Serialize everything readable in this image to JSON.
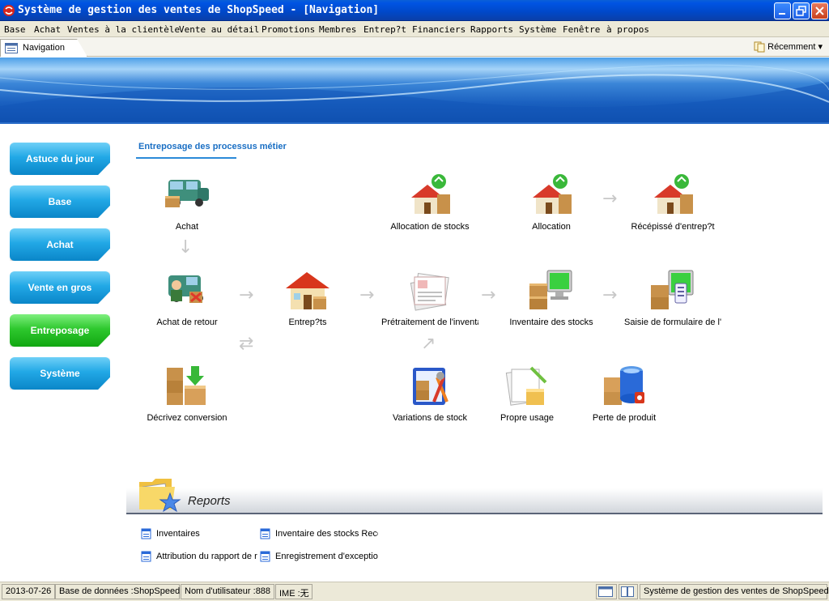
{
  "window": {
    "title": "Système de gestion des ventes de ShopSpeed - [Navigation]"
  },
  "menu": [
    "Base",
    "Achat",
    "Ventes à la clientèle",
    "Vente au détail",
    "Promotions",
    "Membres",
    "Entrep?t",
    "Financiers",
    "Rapports",
    "Système",
    "Fenêtre",
    "à propos"
  ],
  "tabs": {
    "navigation": "Navigation",
    "recent": "Récemment ▾"
  },
  "sidebar": {
    "items": [
      {
        "label": "Astuce du jour"
      },
      {
        "label": "Base"
      },
      {
        "label": "Achat"
      },
      {
        "label": "Vente en gros"
      },
      {
        "label": "Entreposage"
      },
      {
        "label": "Système"
      }
    ],
    "active_color": "#2ec82e",
    "color": "#22a8e6"
  },
  "section": {
    "title": "Entreposage des processus métier"
  },
  "nodes": {
    "achat": "Achat",
    "allocation_stocks": "Allocation de stocks",
    "allocation": "Allocation",
    "recepisse": "Récépissé d'entrep?t",
    "achat_retour": "Achat de retour",
    "entrepots": "Entrep?ts",
    "pretraitement": "Prétraitement de l'inventaire",
    "inventaire_stocks": "Inventaire des stocks",
    "saisie_formulaire": "Saisie de formulaire de l'inventaire",
    "decrivez_conversion": "Décrivez conversion",
    "variations_stock": "Variations de stock",
    "propre_usage": "Propre usage",
    "perte_produit": "Perte de produit"
  },
  "reports": {
    "title": "Reports",
    "links": [
      "Inventaires",
      "Inventaire des stocks Record",
      "Attribution du rapport de requête",
      "Enregistrement d'exception"
    ]
  },
  "status": {
    "date": "2013-07-26",
    "database": "Base de données :ShopSpeed",
    "user": "Nom d'utilisateur :888",
    "ime": "IME :无",
    "app": "Système de gestion des ventes de ShopSpeed"
  }
}
